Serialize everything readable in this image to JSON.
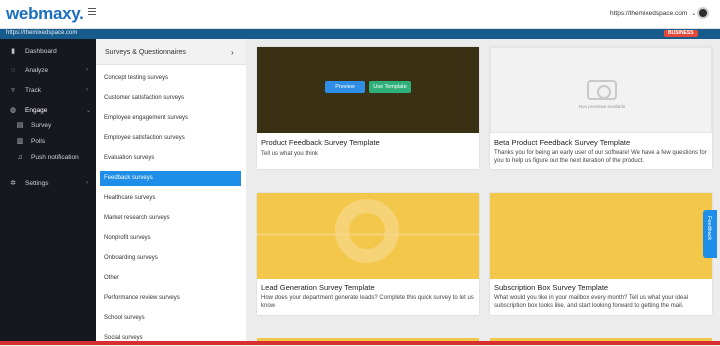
{
  "app": {
    "logo_text": "webmaxy.",
    "site_selector": "https://themixedspace.com",
    "url": "https://themixedspace.com",
    "plan_badge": "BUSINESS",
    "colors": {
      "brand": "#1b6fbf",
      "accent": "#1e8ee8",
      "badge": "#e24b3b"
    }
  },
  "sidebar": {
    "items": [
      {
        "label": "Dashboard",
        "icon": "bar-chart-icon",
        "arrow": ""
      },
      {
        "label": "Analyze",
        "icon": "globe-icon",
        "arrow": "›"
      },
      {
        "label": "Track",
        "icon": "funnel-icon",
        "arrow": "›"
      },
      {
        "label": "Engage",
        "icon": "chat-icon",
        "arrow": "⌄"
      },
      {
        "label": "Survey",
        "icon": "document-icon",
        "arrow": ""
      },
      {
        "label": "Polls",
        "icon": "poll-icon",
        "arrow": ""
      },
      {
        "label": "Push notification",
        "icon": "bell-icon",
        "arrow": ""
      },
      {
        "label": "Settings",
        "icon": "gear-icon",
        "arrow": "›"
      }
    ]
  },
  "categories": {
    "header": "Surveys & Questionnaires",
    "header_chevron": "›",
    "items": [
      "Concept testing surveys",
      "Customer satisfaction surveys",
      "Employee engagement surveys",
      "Employee satisfaction surveys",
      "Evaluation surveys",
      "Feedback surveys",
      "Healthcare surveys",
      "Market research surveys",
      "Nonprofit surveys",
      "Onboarding surveys",
      "Other",
      "Performance review surveys",
      "School surveys",
      "Social surveys"
    ],
    "selected": "Feedback surveys"
  },
  "templates": [
    {
      "title": "Product Feedback Survey Template",
      "description": "Tell us what you think",
      "preview_label": "Preview",
      "use_label": "Use Template"
    },
    {
      "title": "Beta Product Feedback Survey Template",
      "description": "Thanks you for being an early user of our software! We have a few questions for you to help us figure out the next iteration of the product.",
      "no_preview_text": "Non previewe available"
    },
    {
      "title": "Lead Generation Survey Template",
      "description": "How does your department generate leads? Complete this quick survey to let us know"
    },
    {
      "title": "Subscription Box Survey Template",
      "description": "What would you like in your mailbox every month? Tell us what your ideal subscription box looks like, and start looking forward to getting the mail."
    }
  ],
  "feedback_tab": "Feedback"
}
